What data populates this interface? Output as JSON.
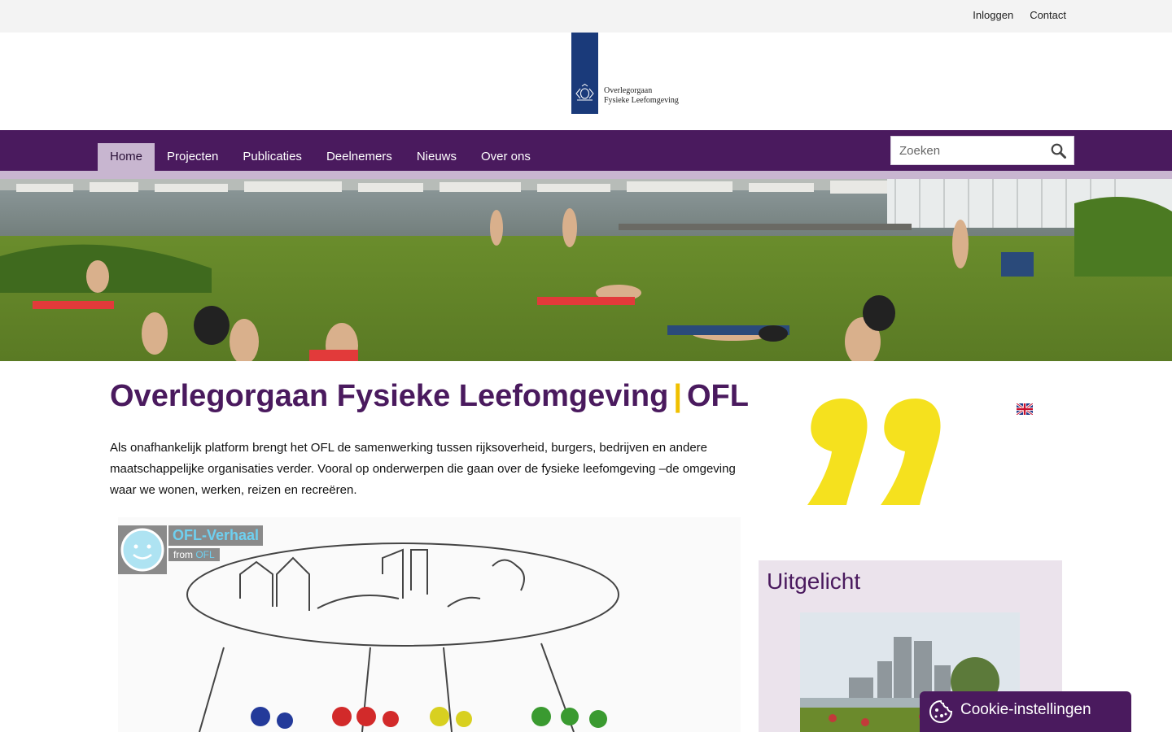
{
  "topbar": {
    "login": "Inloggen",
    "contact": "Contact"
  },
  "logo": {
    "line1": "Overlegorgaan",
    "line2": "Fysieke Leefomgeving"
  },
  "nav": {
    "items": [
      {
        "label": "Home",
        "active": true
      },
      {
        "label": "Projecten"
      },
      {
        "label": "Publicaties"
      },
      {
        "label": "Deelnemers"
      },
      {
        "label": "Nieuws"
      },
      {
        "label": "Over ons"
      }
    ],
    "search_placeholder": "Zoeken"
  },
  "main": {
    "title": "Overlegorgaan Fysieke Leefomgeving",
    "title_sep": "|",
    "title_abbr": "OFL",
    "intro": "Als onafhankelijk platform brengt het OFL de samenwerking tussen rijksoverheid, burgers, bedrijven en andere maatschappelijke organisaties verder. Vooral op onderwerpen die gaan over de fysieke leefomgeving –de omgeving waar we wonen, werken, reizen en recreëren.",
    "video": {
      "title": "OFL-Verhaal",
      "from_label": "from",
      "from_source": "OFL"
    }
  },
  "sidebar": {
    "feature_title": "Uitgelicht"
  },
  "cookie": {
    "label": "Cookie-instellingen"
  },
  "colors": {
    "brand_purple": "#4a1a5e",
    "nav_active": "#c8b6d0",
    "accent_yellow": "#f5e11e",
    "link_cyan": "#6ed0f0"
  },
  "icons": [
    "search-icon",
    "cookie-icon",
    "quote-icon",
    "uk-flag-icon",
    "emoji-avatar-icon",
    "rijksoverheid-crest-icon"
  ]
}
